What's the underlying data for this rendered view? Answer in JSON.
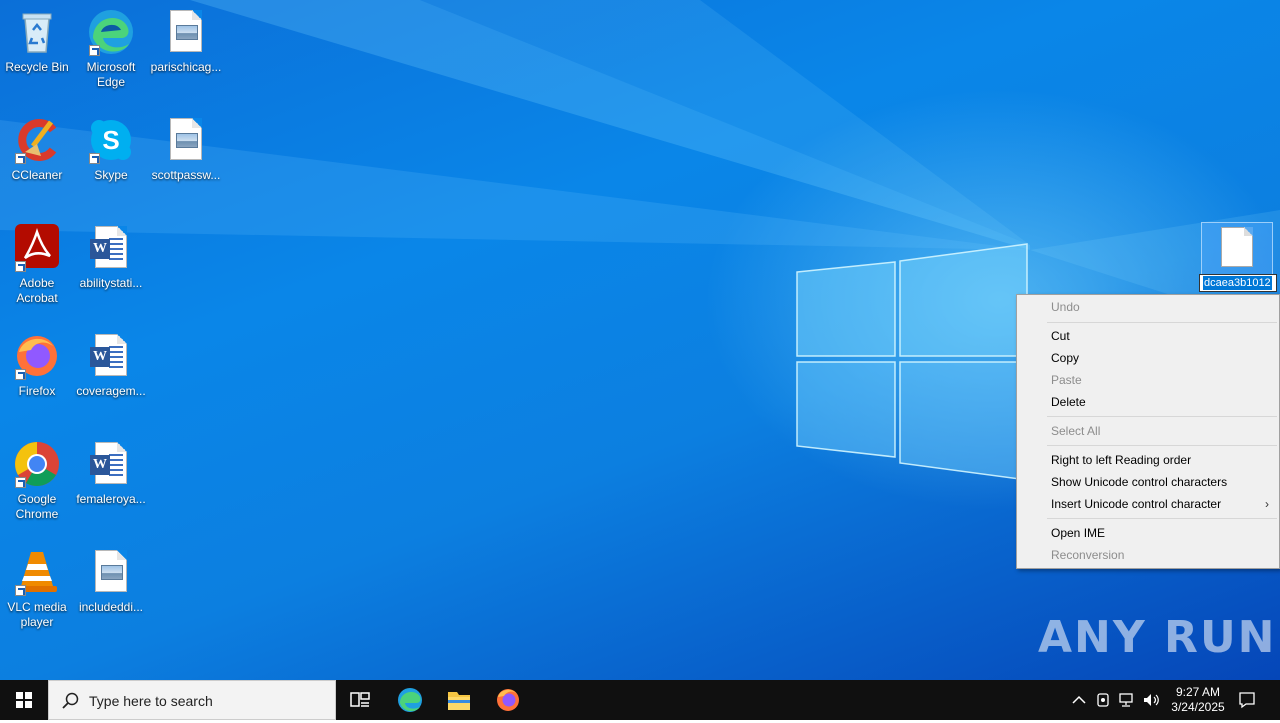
{
  "desktop": {
    "icons": [
      {
        "label": "Recycle Bin",
        "icon": "recycle-bin-icon"
      },
      {
        "label": "Microsoft Edge",
        "icon": "edge-icon"
      },
      {
        "label": "parischicag...",
        "icon": "image-file-icon"
      },
      {
        "label": "CCleaner",
        "icon": "ccleaner-icon"
      },
      {
        "label": "Skype",
        "icon": "skype-icon"
      },
      {
        "label": "scottpassw...",
        "icon": "image-file-icon"
      },
      {
        "label": "Adobe Acrobat",
        "icon": "acrobat-icon"
      },
      {
        "label": "abilitystati...",
        "icon": "word-doc-icon"
      },
      {
        "label": "Firefox",
        "icon": "firefox-icon"
      },
      {
        "label": "coveragem...",
        "icon": "word-doc-icon"
      },
      {
        "label": "Google Chrome",
        "icon": "chrome-icon"
      },
      {
        "label": "femaleroya...",
        "icon": "word-doc-icon"
      },
      {
        "label": "VLC media player",
        "icon": "vlc-icon"
      },
      {
        "label": "includeddi...",
        "icon": "image-file-icon"
      }
    ],
    "selected_file": {
      "rename_value": "dcaea3b1012",
      "icon": "blank-file-icon"
    }
  },
  "context_menu": {
    "items": [
      {
        "label": "Undo",
        "enabled": false
      },
      {
        "label": "Cut",
        "enabled": true
      },
      {
        "label": "Copy",
        "enabled": true
      },
      {
        "label": "Paste",
        "enabled": false
      },
      {
        "label": "Delete",
        "enabled": true
      },
      {
        "label": "Select All",
        "enabled": false
      },
      {
        "label": "Right to left Reading order",
        "enabled": true
      },
      {
        "label": "Show Unicode control characters",
        "enabled": true
      },
      {
        "label": "Insert Unicode control character",
        "enabled": true,
        "submenu": true
      },
      {
        "label": "Open IME",
        "enabled": true
      },
      {
        "label": "Reconversion",
        "enabled": false
      }
    ]
  },
  "watermark": "ANY RUN",
  "taskbar": {
    "search_placeholder": "Type here to search",
    "pinned": [
      "task-view-icon",
      "edge-icon",
      "file-explorer-icon",
      "firefox-icon"
    ],
    "clock": {
      "time": "9:27 AM",
      "date": "3/24/2025"
    }
  },
  "colors": {
    "accent": "#0078d7",
    "taskbar": "#101010",
    "menu_bg": "#f0f0f0"
  }
}
